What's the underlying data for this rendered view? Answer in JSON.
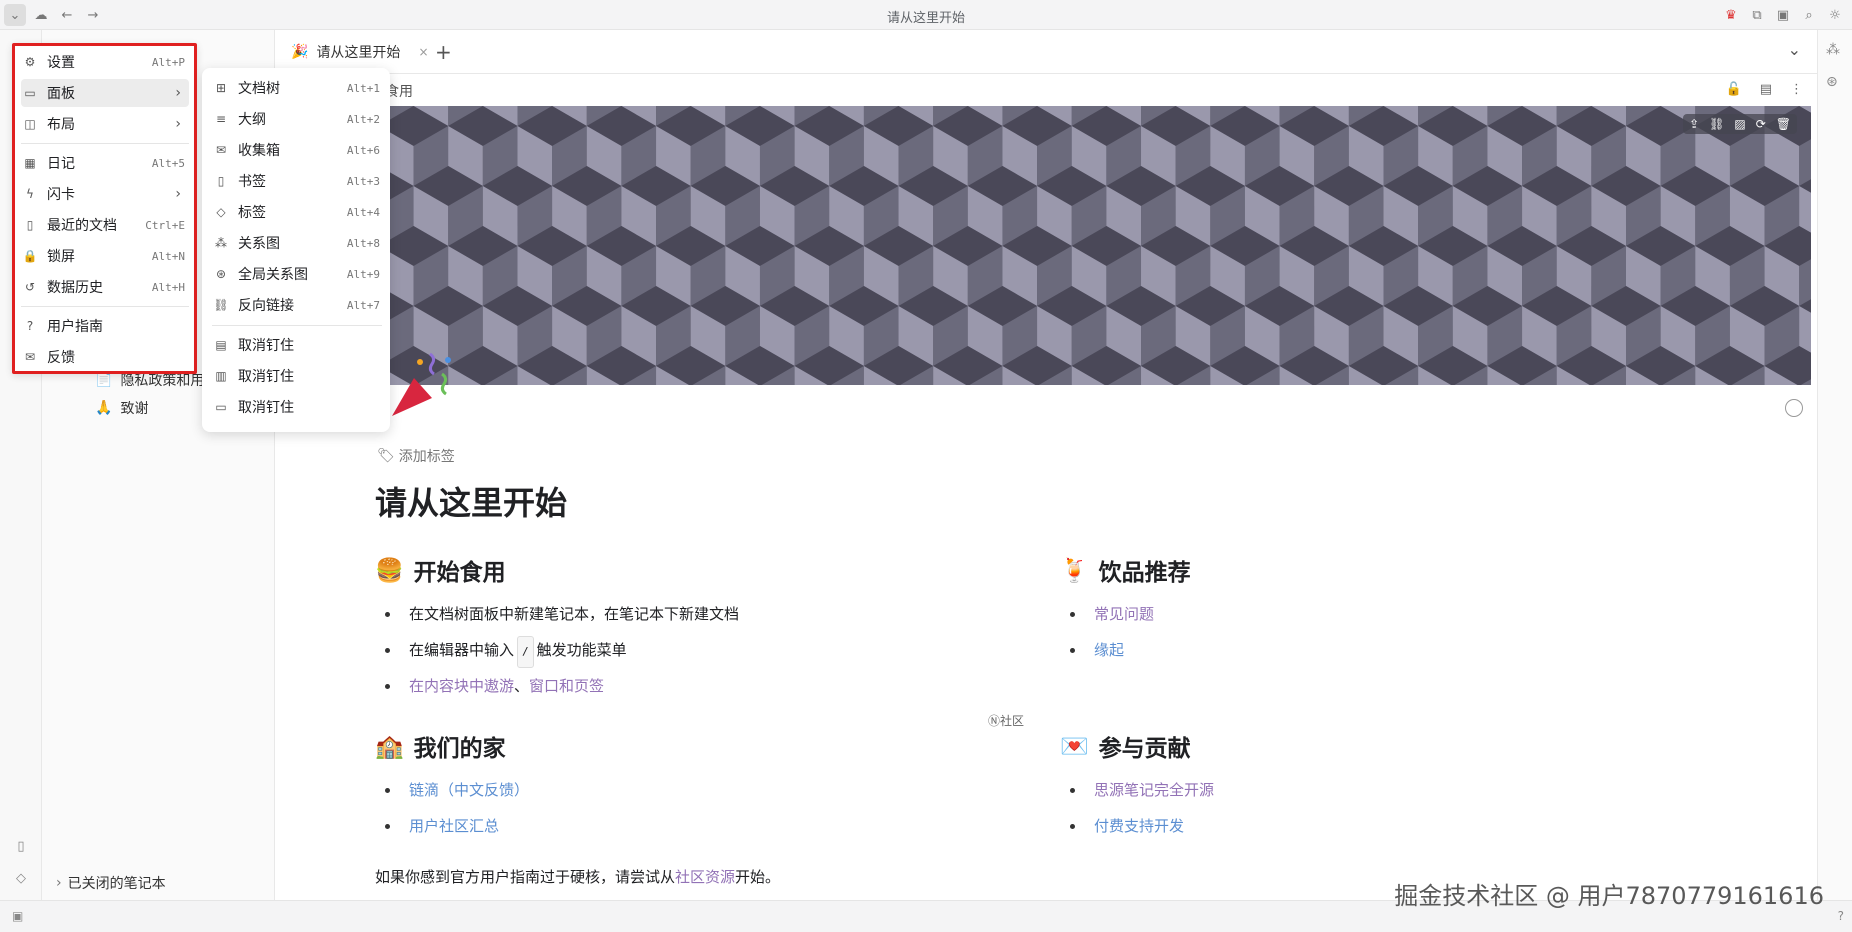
{
  "window": {
    "title": "请从这里开始"
  },
  "tabs": [
    {
      "label": "请从这里开始",
      "close": "×"
    }
  ],
  "tab_add": "+",
  "breadcrumb": {
    "visible_text": "食用"
  },
  "main_menu": {
    "items": [
      {
        "label": "设置",
        "shortcut": "Alt+P",
        "icon": "gear-icon"
      },
      {
        "label": "面板",
        "shortcut": "",
        "icon": "panel-icon",
        "submenu": true
      },
      {
        "label": "布局",
        "shortcut": "",
        "icon": "layout-icon",
        "submenu": true
      },
      {
        "label": "日记",
        "shortcut": "Alt+5",
        "icon": "calendar-icon"
      },
      {
        "label": "闪卡",
        "shortcut": "",
        "icon": "flash-icon",
        "submenu": true
      },
      {
        "label": "最近的文档",
        "shortcut": "Ctrl+E",
        "icon": "file-icon"
      },
      {
        "label": "锁屏",
        "shortcut": "Alt+N",
        "icon": "lock-icon"
      },
      {
        "label": "数据历史",
        "shortcut": "Alt+H",
        "icon": "history-icon"
      },
      {
        "label": "用户指南",
        "shortcut": "",
        "icon": "help-icon"
      },
      {
        "label": "反馈",
        "shortcut": "",
        "icon": "feedback-icon"
      }
    ]
  },
  "panel_submenu": {
    "items": [
      {
        "label": "文档树",
        "shortcut": "Alt+1"
      },
      {
        "label": "大纲",
        "shortcut": "Alt+2"
      },
      {
        "label": "收集箱",
        "shortcut": "Alt+6"
      },
      {
        "label": "书签",
        "shortcut": "Alt+3"
      },
      {
        "label": "标签",
        "shortcut": "Alt+4"
      },
      {
        "label": "关系图",
        "shortcut": "Alt+8"
      },
      {
        "label": "全局关系图",
        "shortcut": "Alt+9"
      },
      {
        "label": "反向链接",
        "shortcut": "Alt+7"
      },
      {
        "label": "取消钉住",
        "shortcut": ""
      },
      {
        "label": "取消钉住",
        "shortcut": ""
      },
      {
        "label": "取消钉住",
        "shortcut": ""
      }
    ]
  },
  "sidebar": {
    "items": [
      {
        "label": "隐私政策和用"
      },
      {
        "label": "致谢"
      }
    ],
    "closed_notebooks": "已关闭的笔记本"
  },
  "document": {
    "add_tag": "添加标签",
    "title": "请从这里开始",
    "sections": {
      "start": {
        "heading": "开始食用",
        "emoji": "🍔",
        "line1": "在文档树面板中新建笔记本，在笔记本下新建文档",
        "line2_pre": "在编辑器中输入",
        "line2_kbd": "/",
        "line2_post": "触发功能菜单",
        "line3_link1": "在内容块中遨游",
        "line3_sep": "、",
        "line3_link2": "窗口和页签"
      },
      "drinks": {
        "heading": "饮品推荐",
        "emoji": "🍹",
        "items": [
          "常见问题",
          "缘起"
        ]
      },
      "home": {
        "heading": "我们的家",
        "emoji": "🏫",
        "items": [
          "链滴（中文反馈）",
          "用户社区汇总"
        ]
      },
      "contribute": {
        "heading": "参与贡献",
        "emoji": "💌",
        "items": [
          "思源笔记完全开源",
          "付费支持开发"
        ]
      }
    },
    "community_badge": "社区",
    "footer_pre": "如果你感到官方用户指南过于硬核，请尝试从",
    "footer_link": "社区资源",
    "footer_post": "开始。"
  },
  "watermark": "掘金技术社区 @ 用户7870779161616",
  "colors": {
    "menu_border": "#e02020",
    "link_blue": "#5b8ed1",
    "link_purple": "#9272b6"
  }
}
